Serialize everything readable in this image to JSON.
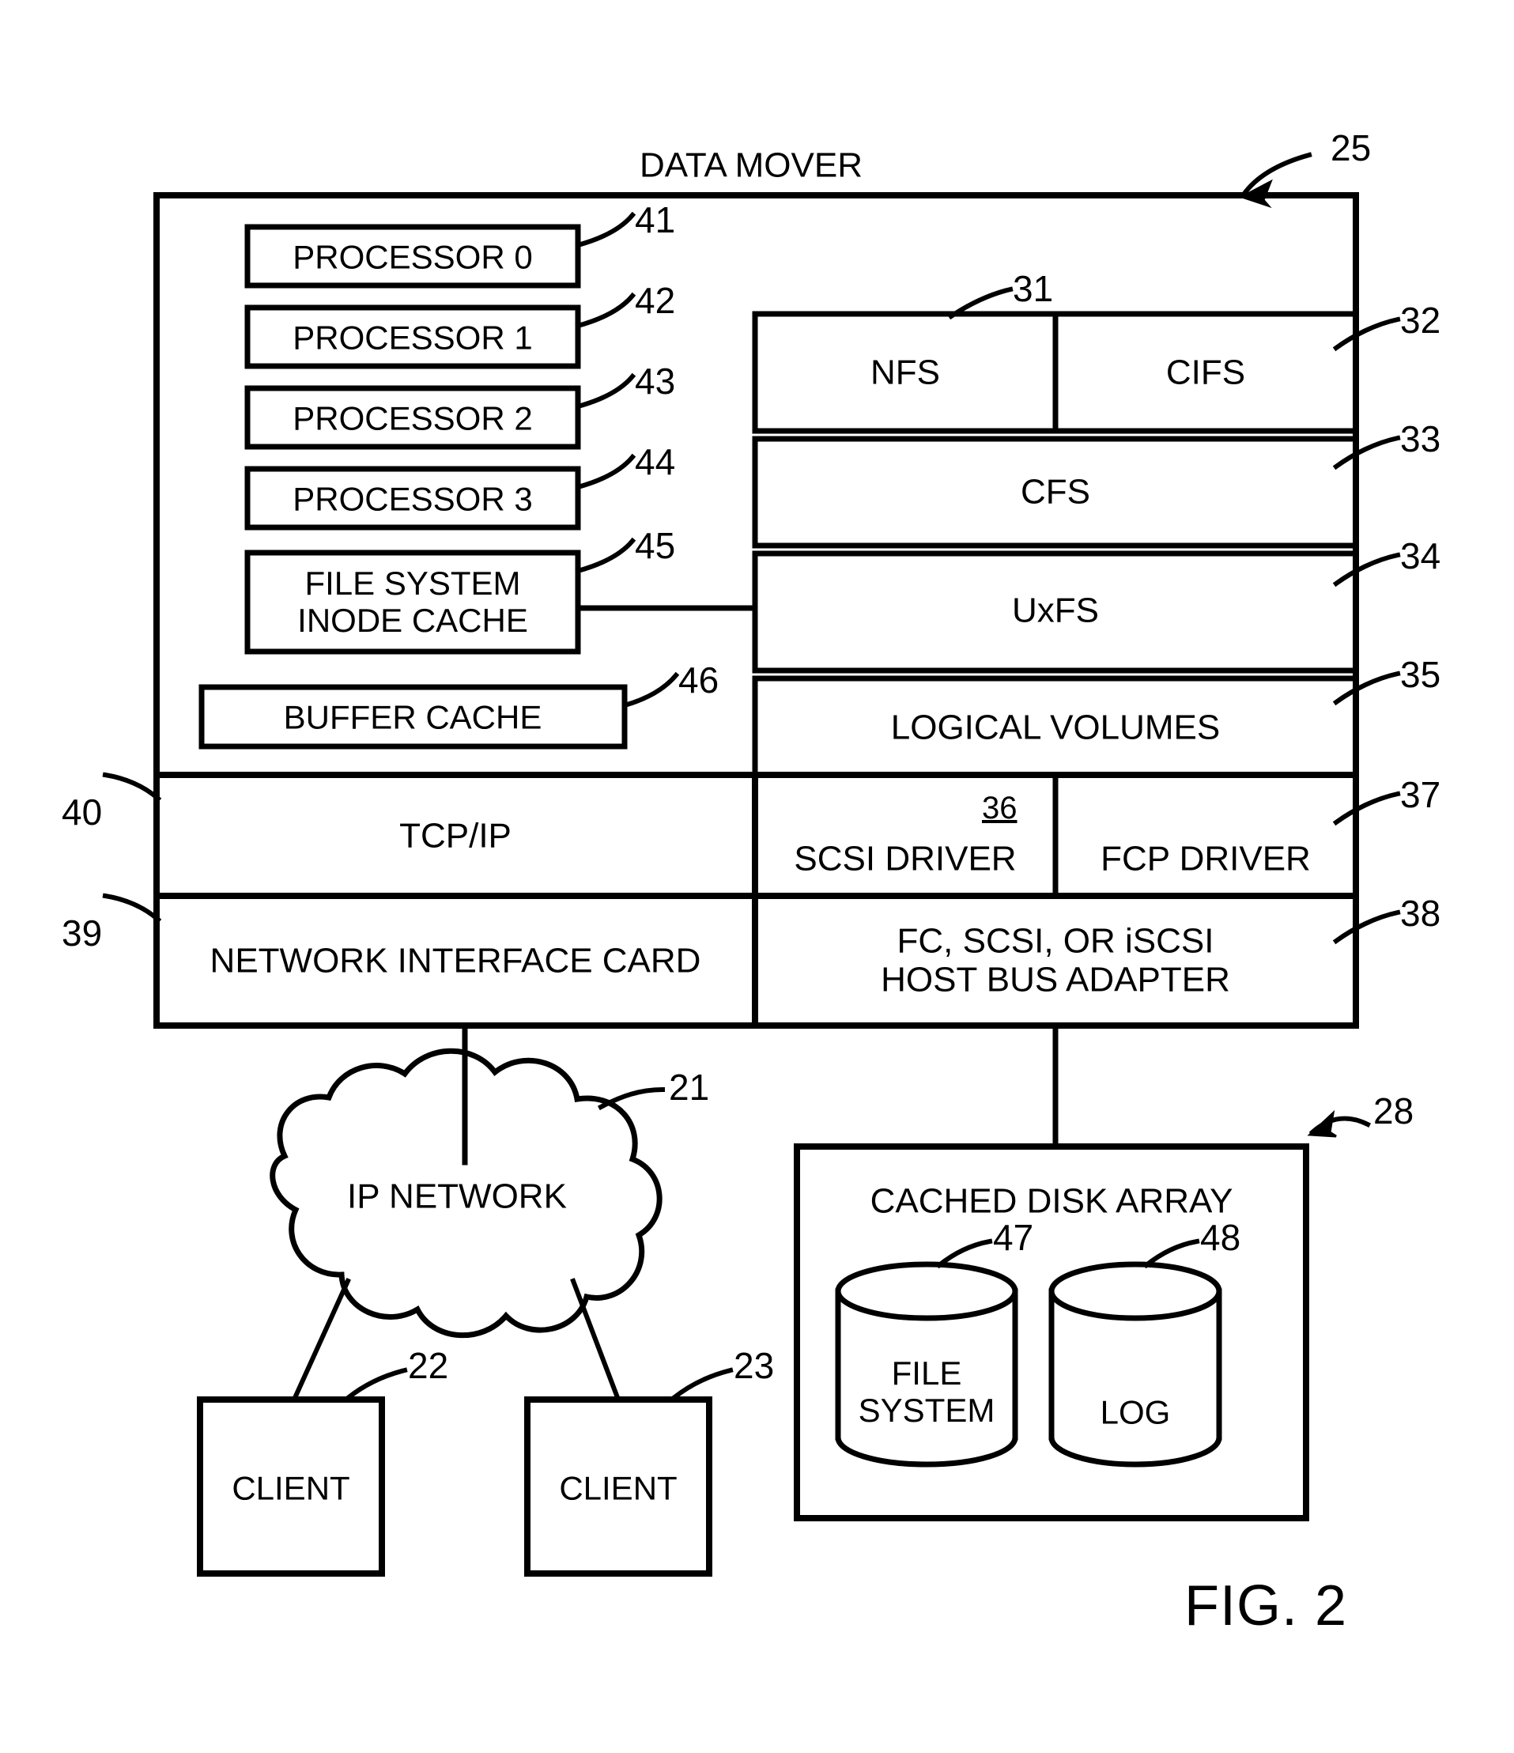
{
  "figure": {
    "name": "FIG. 2",
    "title": "DATA MOVER",
    "title_ref": "25"
  },
  "data_mover": {
    "label": "DATA MOVER",
    "ref": "25",
    "processors": [
      {
        "label": "PROCESSOR 0",
        "ref": "41"
      },
      {
        "label": "PROCESSOR 1",
        "ref": "42"
      },
      {
        "label": "PROCESSOR 2",
        "ref": "43"
      },
      {
        "label": "PROCESSOR 3",
        "ref": "44"
      }
    ],
    "caches": [
      {
        "label": "FILE SYSTEM\nINODE CACHE",
        "ref": "45"
      },
      {
        "label": "BUFFER CACHE",
        "ref": "46"
      }
    ],
    "software_stack": [
      {
        "label": "NFS",
        "ref": "31"
      },
      {
        "label": "CIFS",
        "ref": "32"
      },
      {
        "label": "CFS",
        "ref": "33"
      },
      {
        "label": "UxFS",
        "ref": "34"
      },
      {
        "label": "LOGICAL VOLUMES",
        "ref": "35"
      }
    ],
    "drivers": [
      {
        "label": "SCSI DRIVER",
        "ref": "36"
      },
      {
        "label": "FCP DRIVER",
        "ref": "37"
      }
    ],
    "network_layers": [
      {
        "label": "TCP/IP",
        "ref": "40"
      },
      {
        "label": "NETWORK INTERFACE CARD",
        "ref": "39"
      }
    ],
    "host_bus_adapter": {
      "label": "FC, SCSI, OR iSCSI\nHOST BUS ADAPTER",
      "ref": "38"
    }
  },
  "network": {
    "cloud_label": "IP NETWORK",
    "cloud_ref": "21",
    "clients": [
      {
        "label": "CLIENT",
        "ref": "22"
      },
      {
        "label": "CLIENT",
        "ref": "23"
      }
    ]
  },
  "storage": {
    "label": "CACHED DISK ARRAY",
    "ref": "28",
    "volumes": [
      {
        "label": "FILE\nSYSTEM",
        "ref": "47"
      },
      {
        "label": "LOG",
        "ref": "48"
      }
    ]
  }
}
